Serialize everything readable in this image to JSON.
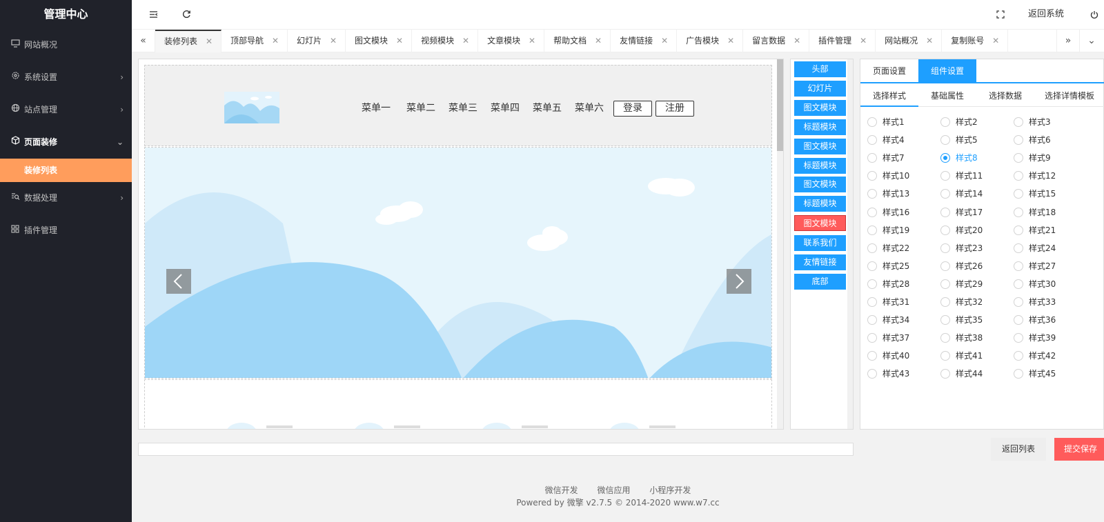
{
  "sidebar": {
    "title": "管理中心",
    "items": [
      {
        "label": "网站概况",
        "icon": "monitor-icon"
      },
      {
        "label": "系统设置",
        "icon": "gear-icon",
        "arrow": "chevron-right-icon"
      },
      {
        "label": "站点管理",
        "icon": "globe-icon",
        "arrow": "chevron-right-icon"
      },
      {
        "label": "页面装修",
        "icon": "cube-icon",
        "arrow": "chevron-down-icon"
      },
      {
        "label": "数据处理",
        "icon": "data-search-icon",
        "arrow": "chevron-right-icon"
      },
      {
        "label": "插件管理",
        "icon": "grid-icon"
      }
    ],
    "sub_item": "装修列表"
  },
  "header": {
    "back_system": "返回系统"
  },
  "tabs": [
    {
      "label": "装修列表",
      "active": true
    },
    {
      "label": "顶部导航"
    },
    {
      "label": "幻灯片"
    },
    {
      "label": "图文模块"
    },
    {
      "label": "视频模块"
    },
    {
      "label": "文章模块"
    },
    {
      "label": "帮助文档"
    },
    {
      "label": "友情链接"
    },
    {
      "label": "广告模块"
    },
    {
      "label": "留言数据"
    },
    {
      "label": "插件管理"
    },
    {
      "label": "网站概况"
    },
    {
      "label": "复制账号"
    }
  ],
  "preview": {
    "menu": [
      "菜单一",
      "菜单二",
      "菜单三",
      "菜单四",
      "菜单五",
      "菜单六"
    ],
    "login": "登录",
    "register": "注册"
  },
  "modules": [
    {
      "label": "头部"
    },
    {
      "label": "幻灯片"
    },
    {
      "label": "图文模块"
    },
    {
      "label": "标题模块"
    },
    {
      "label": "图文模块"
    },
    {
      "label": "标题模块"
    },
    {
      "label": "图文模块"
    },
    {
      "label": "标题模块"
    },
    {
      "label": "图文模块",
      "selected": true
    },
    {
      "label": "联系我们"
    },
    {
      "label": "友情链接"
    },
    {
      "label": "底部"
    }
  ],
  "settings": {
    "tabs": [
      "页面设置",
      "组件设置"
    ],
    "active_tab": "组件设置",
    "subtabs": [
      "选择样式",
      "基础属性",
      "选择数据",
      "选择详情模板"
    ],
    "styles": [
      "样式1",
      "样式2",
      "样式3",
      "样式4",
      "样式5",
      "样式6",
      "样式7",
      "样式8",
      "样式9",
      "样式10",
      "样式11",
      "样式12",
      "样式13",
      "样式14",
      "样式15",
      "样式16",
      "样式17",
      "样式18",
      "样式19",
      "样式20",
      "样式21",
      "样式22",
      "样式23",
      "样式24",
      "样式25",
      "样式26",
      "样式27",
      "样式28",
      "样式29",
      "样式30",
      "样式31",
      "样式32",
      "样式33",
      "样式34",
      "样式35",
      "样式36",
      "样式37",
      "样式38",
      "样式39",
      "样式40",
      "样式41",
      "样式42",
      "样式43",
      "样式44",
      "样式45"
    ],
    "selected_style": "样式8"
  },
  "actions": {
    "back_list": "返回列表",
    "submit": "提交保存"
  },
  "footer": {
    "links": [
      "微信开发",
      "微信应用",
      "小程序开发"
    ],
    "copyright": "Powered by 微擎 v2.7.5 © 2014-2020 www.w7.cc"
  },
  "colors": {
    "sidebar_bg": "#20222a",
    "accent_orange": "#ff9d5c",
    "primary_blue": "#1e9fff",
    "danger_red": "#ff5b5b"
  }
}
